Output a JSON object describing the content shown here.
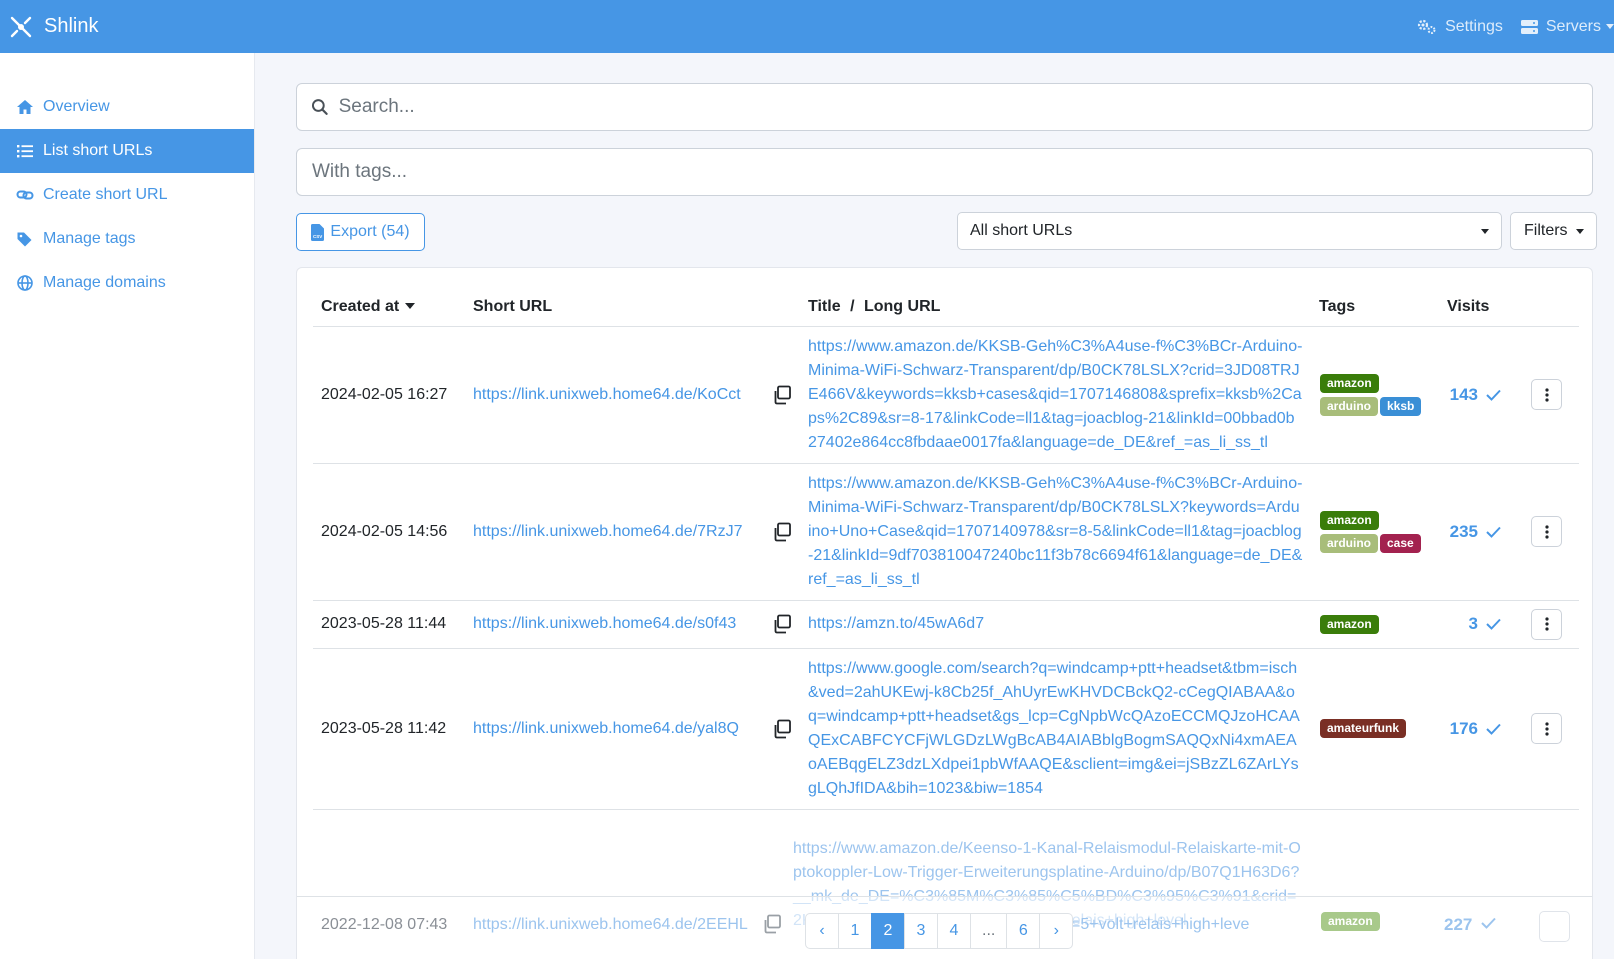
{
  "app": {
    "title": "Shlink"
  },
  "navbar": {
    "settings_label": "Settings",
    "servers_label": "Servers"
  },
  "sidebar": {
    "items": [
      {
        "label": "Overview",
        "icon": "home-icon"
      },
      {
        "label": "List short URLs",
        "icon": "list-icon",
        "active": true
      },
      {
        "label": "Create short URL",
        "icon": "link-icon"
      },
      {
        "label": "Manage tags",
        "icon": "tags-icon"
      },
      {
        "label": "Manage domains",
        "icon": "globe-icon"
      }
    ]
  },
  "search": {
    "placeholder": "Search..."
  },
  "tags_filter": {
    "placeholder": "With tags..."
  },
  "toolbar": {
    "export_label": "Export (54)",
    "select_value": "All short URLs",
    "filters_label": "Filters"
  },
  "table": {
    "headers": {
      "created": "Created at",
      "short": "Short URL",
      "title": "Title",
      "sep": "/",
      "long": "Long URL",
      "tags": "Tags",
      "visits": "Visits"
    },
    "rows": [
      {
        "created": "2024-02-05 16:27",
        "short": "https://link.unixweb.home64.de/KoCct",
        "long": "https://www.amazon.de/KKSB-Geh%C3%A4use-f%C3%BCr-Arduino-Minima-WiFi-Schwarz-Transparent/dp/B0CK78LSLX?crid=3JD08TRJE466V&keywords=kksb+cases&qid=1707146808&sprefix=kksb%2Caps%2C89&sr=8-17&linkCode=ll1&tag=joacblog-21&linkId=00bbad0b27402e864cc8fbdaae0017fa&language=de_DE&ref_=as_li_ss_tl",
        "tags": [
          {
            "name": "amazon",
            "color": "#3a7d0a"
          },
          {
            "name": "arduino",
            "color": "#a8bd7a"
          },
          {
            "name": "kksb",
            "color": "#3a8fd6"
          }
        ],
        "visits": "143"
      },
      {
        "created": "2024-02-05 14:56",
        "short": "https://link.unixweb.home64.de/7RzJ7",
        "long": "https://www.amazon.de/KKSB-Geh%C3%A4use-f%C3%BCr-Arduino-Minima-WiFi-Schwarz-Transparent/dp/B0CK78LSLX?keywords=Arduino+Uno+Case&qid=1707140978&sr=8-5&linkCode=ll1&tag=joacblog-21&linkId=9df703810047240bc11f3b78c6694f61&language=de_DE&ref_=as_li_ss_tl",
        "tags": [
          {
            "name": "amazon",
            "color": "#3a7d0a"
          },
          {
            "name": "arduino",
            "color": "#a8bd7a"
          },
          {
            "name": "case",
            "color": "#a3224f"
          }
        ],
        "visits": "235"
      },
      {
        "created": "2023-05-28 11:44",
        "short": "https://link.unixweb.home64.de/s0f43",
        "long": "https://amzn.to/45wA6d7",
        "tags": [
          {
            "name": "amazon",
            "color": "#3a7d0a"
          }
        ],
        "visits": "3"
      },
      {
        "created": "2023-05-28 11:42",
        "short": "https://link.unixweb.home64.de/yal8Q",
        "long": "https://www.google.com/search?q=windcamp+ptt+headset&tbm=isch&ved=2ahUKEwj-k8Cb25f_AhUyrEwKHVDCBckQ2-cCegQIABAA&oq=windcamp+ptt+headset&gs_lcp=CgNpbWcQAzoECCMQJzoHCAAQExCABFCYCFjWLGDzLWgBcAB4AIABblgBogmSAQQxNi4xmAEAoAEBqgELZ3dzLXdpei1pbWfAAQE&sclient=img&ei=jSBzZL6ZArLYsgLQhJfIDA&bih=1023&biw=1854",
        "tags": [
          {
            "name": "amateurfunk",
            "color": "#7a2f25"
          }
        ],
        "visits": "176"
      }
    ],
    "partial_row": {
      "long": "https://www.amazon.de/Keenso-1-Kanal-Relaismodul-Relaiskarte-mit-Optokoppler-Low-Trigger-Erweiterungsplatine-Arduino/dp/B07Q1H63D6?__mk_de_DE=%C3%85M%C3%85%C5%BD%C3%95%C3%91&crid=2KIQ2MHEUSXZF&keywords=5+volt+relais+high+level"
    },
    "faded_row": {
      "created": "2022-12-08 07:43",
      "short": "https://link.unixweb.home64.de/2EEHL",
      "long_tail": "fix=5+volt+relais+high+leve",
      "tags": [
        {
          "name": "amazon",
          "color": "#a8c98a"
        }
      ],
      "visits": "227"
    }
  },
  "pagination": {
    "prev": "‹",
    "pages": [
      "1",
      "2",
      "3",
      "4",
      "...",
      "6"
    ],
    "active": "2",
    "next": "›"
  }
}
